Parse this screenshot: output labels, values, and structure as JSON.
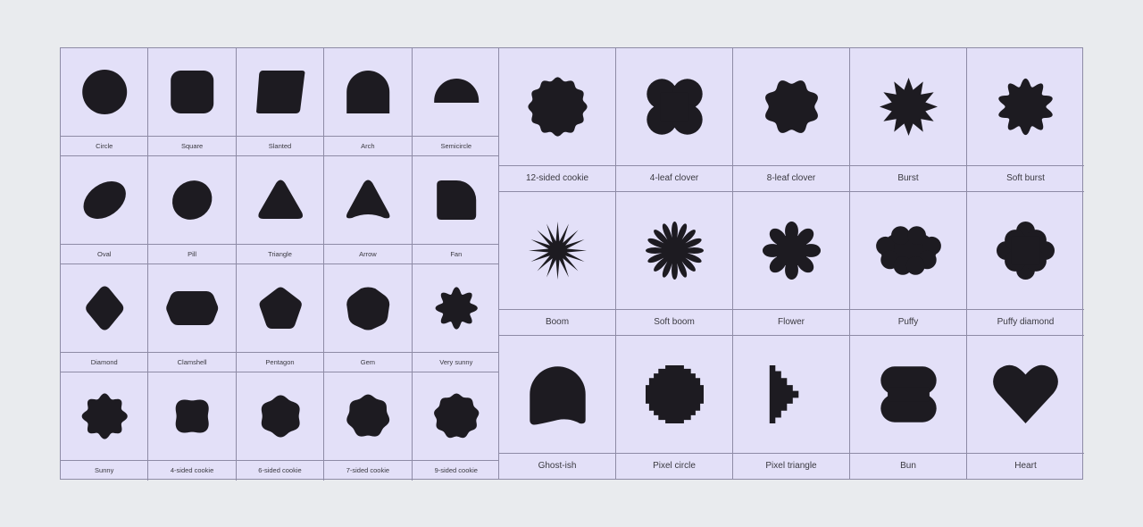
{
  "colors": {
    "page_background": "#e9ebee",
    "panel_fill": "#e3e0f8",
    "grid_line": "#8e8ba6",
    "shape_fill": "#1d1b21",
    "label_text": "#3a3940"
  },
  "small_grid": {
    "rows": [
      [
        {
          "label": "Circle",
          "icon": "circle-shape-icon"
        },
        {
          "label": "Square",
          "icon": "square-shape-icon"
        },
        {
          "label": "Slanted",
          "icon": "slanted-shape-icon"
        },
        {
          "label": "Arch",
          "icon": "arch-shape-icon"
        },
        {
          "label": "Semicircle",
          "icon": "semicircle-shape-icon"
        }
      ],
      [
        {
          "label": "Oval",
          "icon": "oval-shape-icon"
        },
        {
          "label": "Pill",
          "icon": "pill-shape-icon"
        },
        {
          "label": "Triangle",
          "icon": "triangle-shape-icon"
        },
        {
          "label": "Arrow",
          "icon": "arrow-shape-icon"
        },
        {
          "label": "Fan",
          "icon": "fan-shape-icon"
        }
      ],
      [
        {
          "label": "Diamond",
          "icon": "diamond-shape-icon"
        },
        {
          "label": "Clamshell",
          "icon": "clamshell-shape-icon"
        },
        {
          "label": "Pentagon",
          "icon": "pentagon-shape-icon"
        },
        {
          "label": "Gem",
          "icon": "gem-shape-icon"
        },
        {
          "label": "Very sunny",
          "icon": "very-sunny-shape-icon"
        }
      ],
      [
        {
          "label": "Sunny",
          "icon": "sunny-shape-icon"
        },
        {
          "label": "4-sided cookie",
          "icon": "4-sided-cookie-shape-icon"
        },
        {
          "label": "6-sided cookie",
          "icon": "6-sided-cookie-shape-icon"
        },
        {
          "label": "7-sided cookie",
          "icon": "7-sided-cookie-shape-icon"
        },
        {
          "label": "9-sided cookie",
          "icon": "9-sided-cookie-shape-icon"
        }
      ]
    ]
  },
  "large_grid": {
    "rows": [
      [
        {
          "label": "12-sided cookie",
          "icon": "12-sided-cookie-shape-icon"
        },
        {
          "label": "4-leaf clover",
          "icon": "4-leaf-clover-shape-icon"
        },
        {
          "label": "8-leaf clover",
          "icon": "8-leaf-clover-shape-icon"
        },
        {
          "label": "Burst",
          "icon": "burst-shape-icon"
        },
        {
          "label": "Soft burst",
          "icon": "soft-burst-shape-icon"
        }
      ],
      [
        {
          "label": "Boom",
          "icon": "boom-shape-icon"
        },
        {
          "label": "Soft boom",
          "icon": "soft-boom-shape-icon"
        },
        {
          "label": "Flower",
          "icon": "flower-shape-icon"
        },
        {
          "label": "Puffy",
          "icon": "puffy-shape-icon"
        },
        {
          "label": "Puffy diamond",
          "icon": "puffy-diamond-shape-icon"
        }
      ],
      [
        {
          "label": "Ghost-ish",
          "icon": "ghost-ish-shape-icon"
        },
        {
          "label": "Pixel circle",
          "icon": "pixel-circle-shape-icon"
        },
        {
          "label": "Pixel triangle",
          "icon": "pixel-triangle-shape-icon"
        },
        {
          "label": "Bun",
          "icon": "bun-shape-icon"
        },
        {
          "label": "Heart",
          "icon": "heart-shape-icon"
        }
      ]
    ]
  }
}
